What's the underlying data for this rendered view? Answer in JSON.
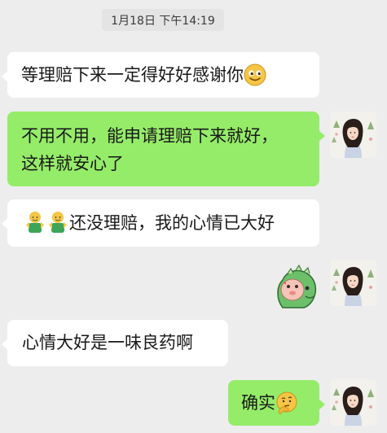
{
  "timestamp": "1月18日 下午14:19",
  "messages": [
    {
      "side": "in",
      "text": "等理赔下来一定得好好感谢你",
      "emoji": "smile-emoji"
    },
    {
      "side": "out",
      "line1": "不用不用，能申请理赔下来就好，",
      "line2": "这样就安心了"
    },
    {
      "side": "in",
      "text": "还没理赔，我的心情已大好",
      "emoji": "thumbs-up-emoji"
    },
    {
      "side": "out",
      "sticker": "dinosaur-sticker"
    },
    {
      "side": "in",
      "text": "心情大好是一味良药啊"
    },
    {
      "side": "out",
      "text": "确实",
      "emoji": "thinking-emoji"
    }
  ],
  "colors": {
    "background": "#ededed",
    "incoming_bubble": "#ffffff",
    "outgoing_bubble": "#95ec69",
    "timestamp_bg": "#e4e4e4"
  }
}
